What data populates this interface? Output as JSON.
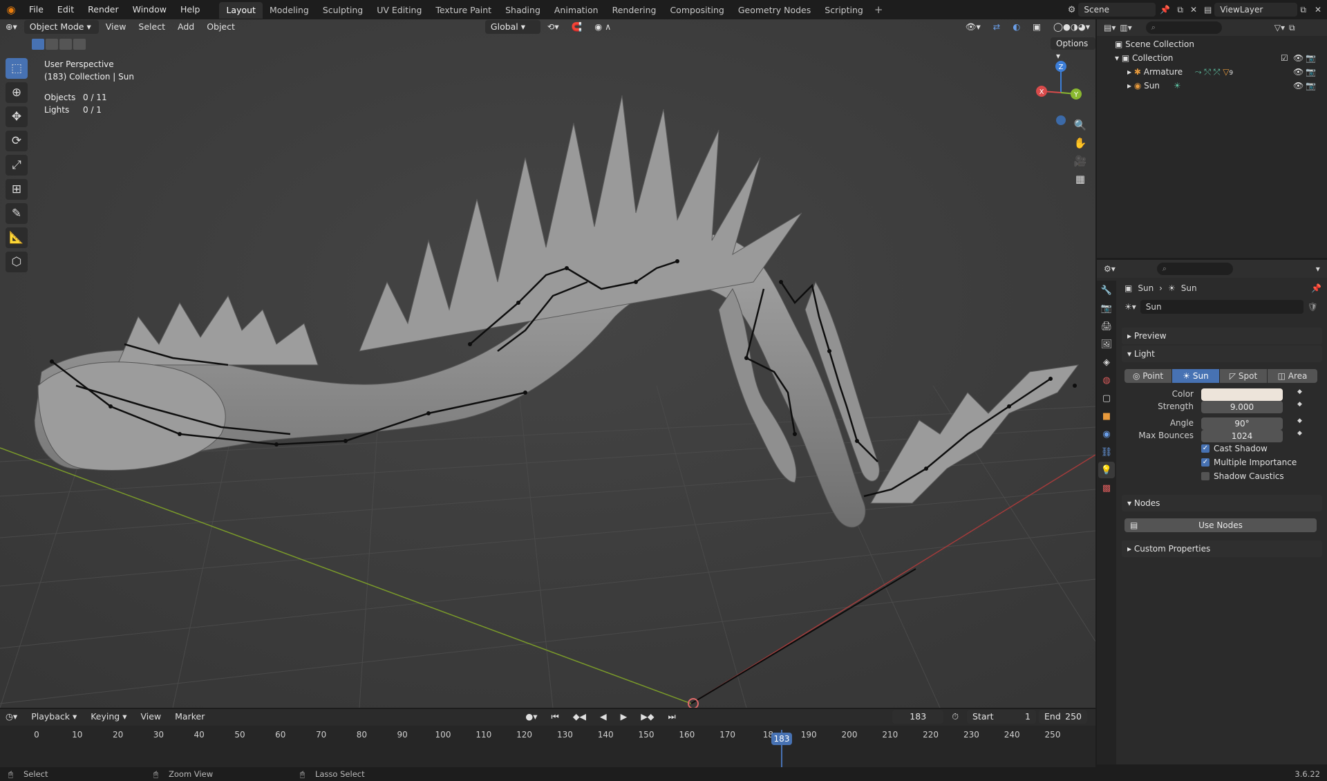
{
  "topbar": {
    "menus": [
      "File",
      "Edit",
      "Render",
      "Window",
      "Help"
    ],
    "workspaces": [
      "Layout",
      "Modeling",
      "Sculpting",
      "UV Editing",
      "Texture Paint",
      "Shading",
      "Animation",
      "Rendering",
      "Compositing",
      "Geometry Nodes",
      "Scripting"
    ],
    "active_workspace": "Layout",
    "scene": "Scene",
    "view_layer": "ViewLayer"
  },
  "viewport": {
    "mode": "Object Mode",
    "menus": [
      "View",
      "Select",
      "Add",
      "Object"
    ],
    "orientation": "Global",
    "options_label": "Options",
    "perspective": "User Perspective",
    "context": "(183) Collection | Sun",
    "stats": [
      {
        "label": "Objects",
        "value": "0 / 11"
      },
      {
        "label": "Lights",
        "value": "0 / 1"
      }
    ],
    "gizmo": {
      "z": "Z",
      "x": "X",
      "y": "Y"
    }
  },
  "outliner": {
    "scene_collection": "Scene Collection",
    "collection": "Collection",
    "items": [
      {
        "name": "Armature",
        "badge": "9"
      },
      {
        "name": "Sun",
        "badge": ""
      }
    ]
  },
  "properties": {
    "breadcrumb": [
      "Sun",
      "Sun"
    ],
    "datablock": "Sun",
    "panels": {
      "preview": "Preview",
      "light": "Light",
      "nodes": "Nodes",
      "custom": "Custom Properties"
    },
    "light_types": [
      "Point",
      "Sun",
      "Spot",
      "Area"
    ],
    "active_type": "Sun",
    "color_label": "Color",
    "color_value": "#ede4da",
    "strength_label": "Strength",
    "strength": "9.000",
    "angle_label": "Angle",
    "angle": "90°",
    "bounces_label": "Max Bounces",
    "bounces": "1024",
    "checks": [
      {
        "label": "Cast Shadow",
        "on": true
      },
      {
        "label": "Multiple Importance",
        "on": true
      },
      {
        "label": "Shadow Caustics",
        "on": false
      }
    ],
    "use_nodes": "Use Nodes"
  },
  "timeline": {
    "menus": [
      "Playback",
      "Keying",
      "View",
      "Marker"
    ],
    "current_frame": "183",
    "start_label": "Start",
    "start": "1",
    "end_label": "End",
    "end": "250",
    "ticks": [
      "0",
      "10",
      "20",
      "30",
      "40",
      "50",
      "60",
      "70",
      "80",
      "90",
      "100",
      "110",
      "120",
      "130",
      "140",
      "150",
      "160",
      "170",
      "18",
      "190",
      "200",
      "210",
      "220",
      "230",
      "240",
      "250"
    ]
  },
  "statusbar": {
    "select": "Select",
    "zoom": "Zoom View",
    "lasso": "Lasso Select",
    "version": "3.6.22"
  }
}
